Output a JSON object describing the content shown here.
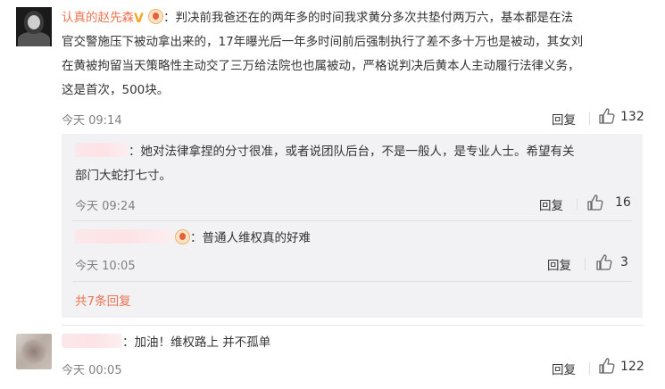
{
  "comments": [
    {
      "author": "认真的赵先森",
      "text_line1": "：判决前我爸还在的两年多的时间我求黄分多次共垫付两万六，基本都是在法",
      "text_line2": "官交警施压下被动拿出来的，17年曝光后一年多时间前后强制执行了差不多十万也是被动，其女刘",
      "text_line3": "在黄被拘留当天策略性主动交了三万给法院也也属被动，严格说判决后黄本人主动履行法律义务，",
      "text_line4": "这是首次，500块。",
      "time": "今天 09:14",
      "reply_label": "回复",
      "likes": "132",
      "replies": [
        {
          "text_line1": "：她对法律拿捏的分寸很准，或者说团队后台，不是一般人，是专业人士。希望有关",
          "text_line2": "部门大蛇打七寸。",
          "time": "今天 09:24",
          "reply_label": "回复",
          "likes": "16"
        },
        {
          "text": "：普通人维权真的好难",
          "time": "今天 10:05",
          "reply_label": "回复",
          "likes": "3"
        }
      ],
      "more_replies": "共7条回复"
    },
    {
      "text": "：加油！维权路上 并不孤单",
      "time": "今天 00:05",
      "reply_label": "回复",
      "likes": "122"
    }
  ],
  "colors": {
    "name": "#eb7350",
    "more_link": "#eb7350",
    "reply_bg": "#f2f2f5",
    "meta": "#808080"
  },
  "icons": {
    "verified": "yellow-v-badge",
    "member": "vip-circle-badge",
    "like": "thumbs-up-icon"
  }
}
